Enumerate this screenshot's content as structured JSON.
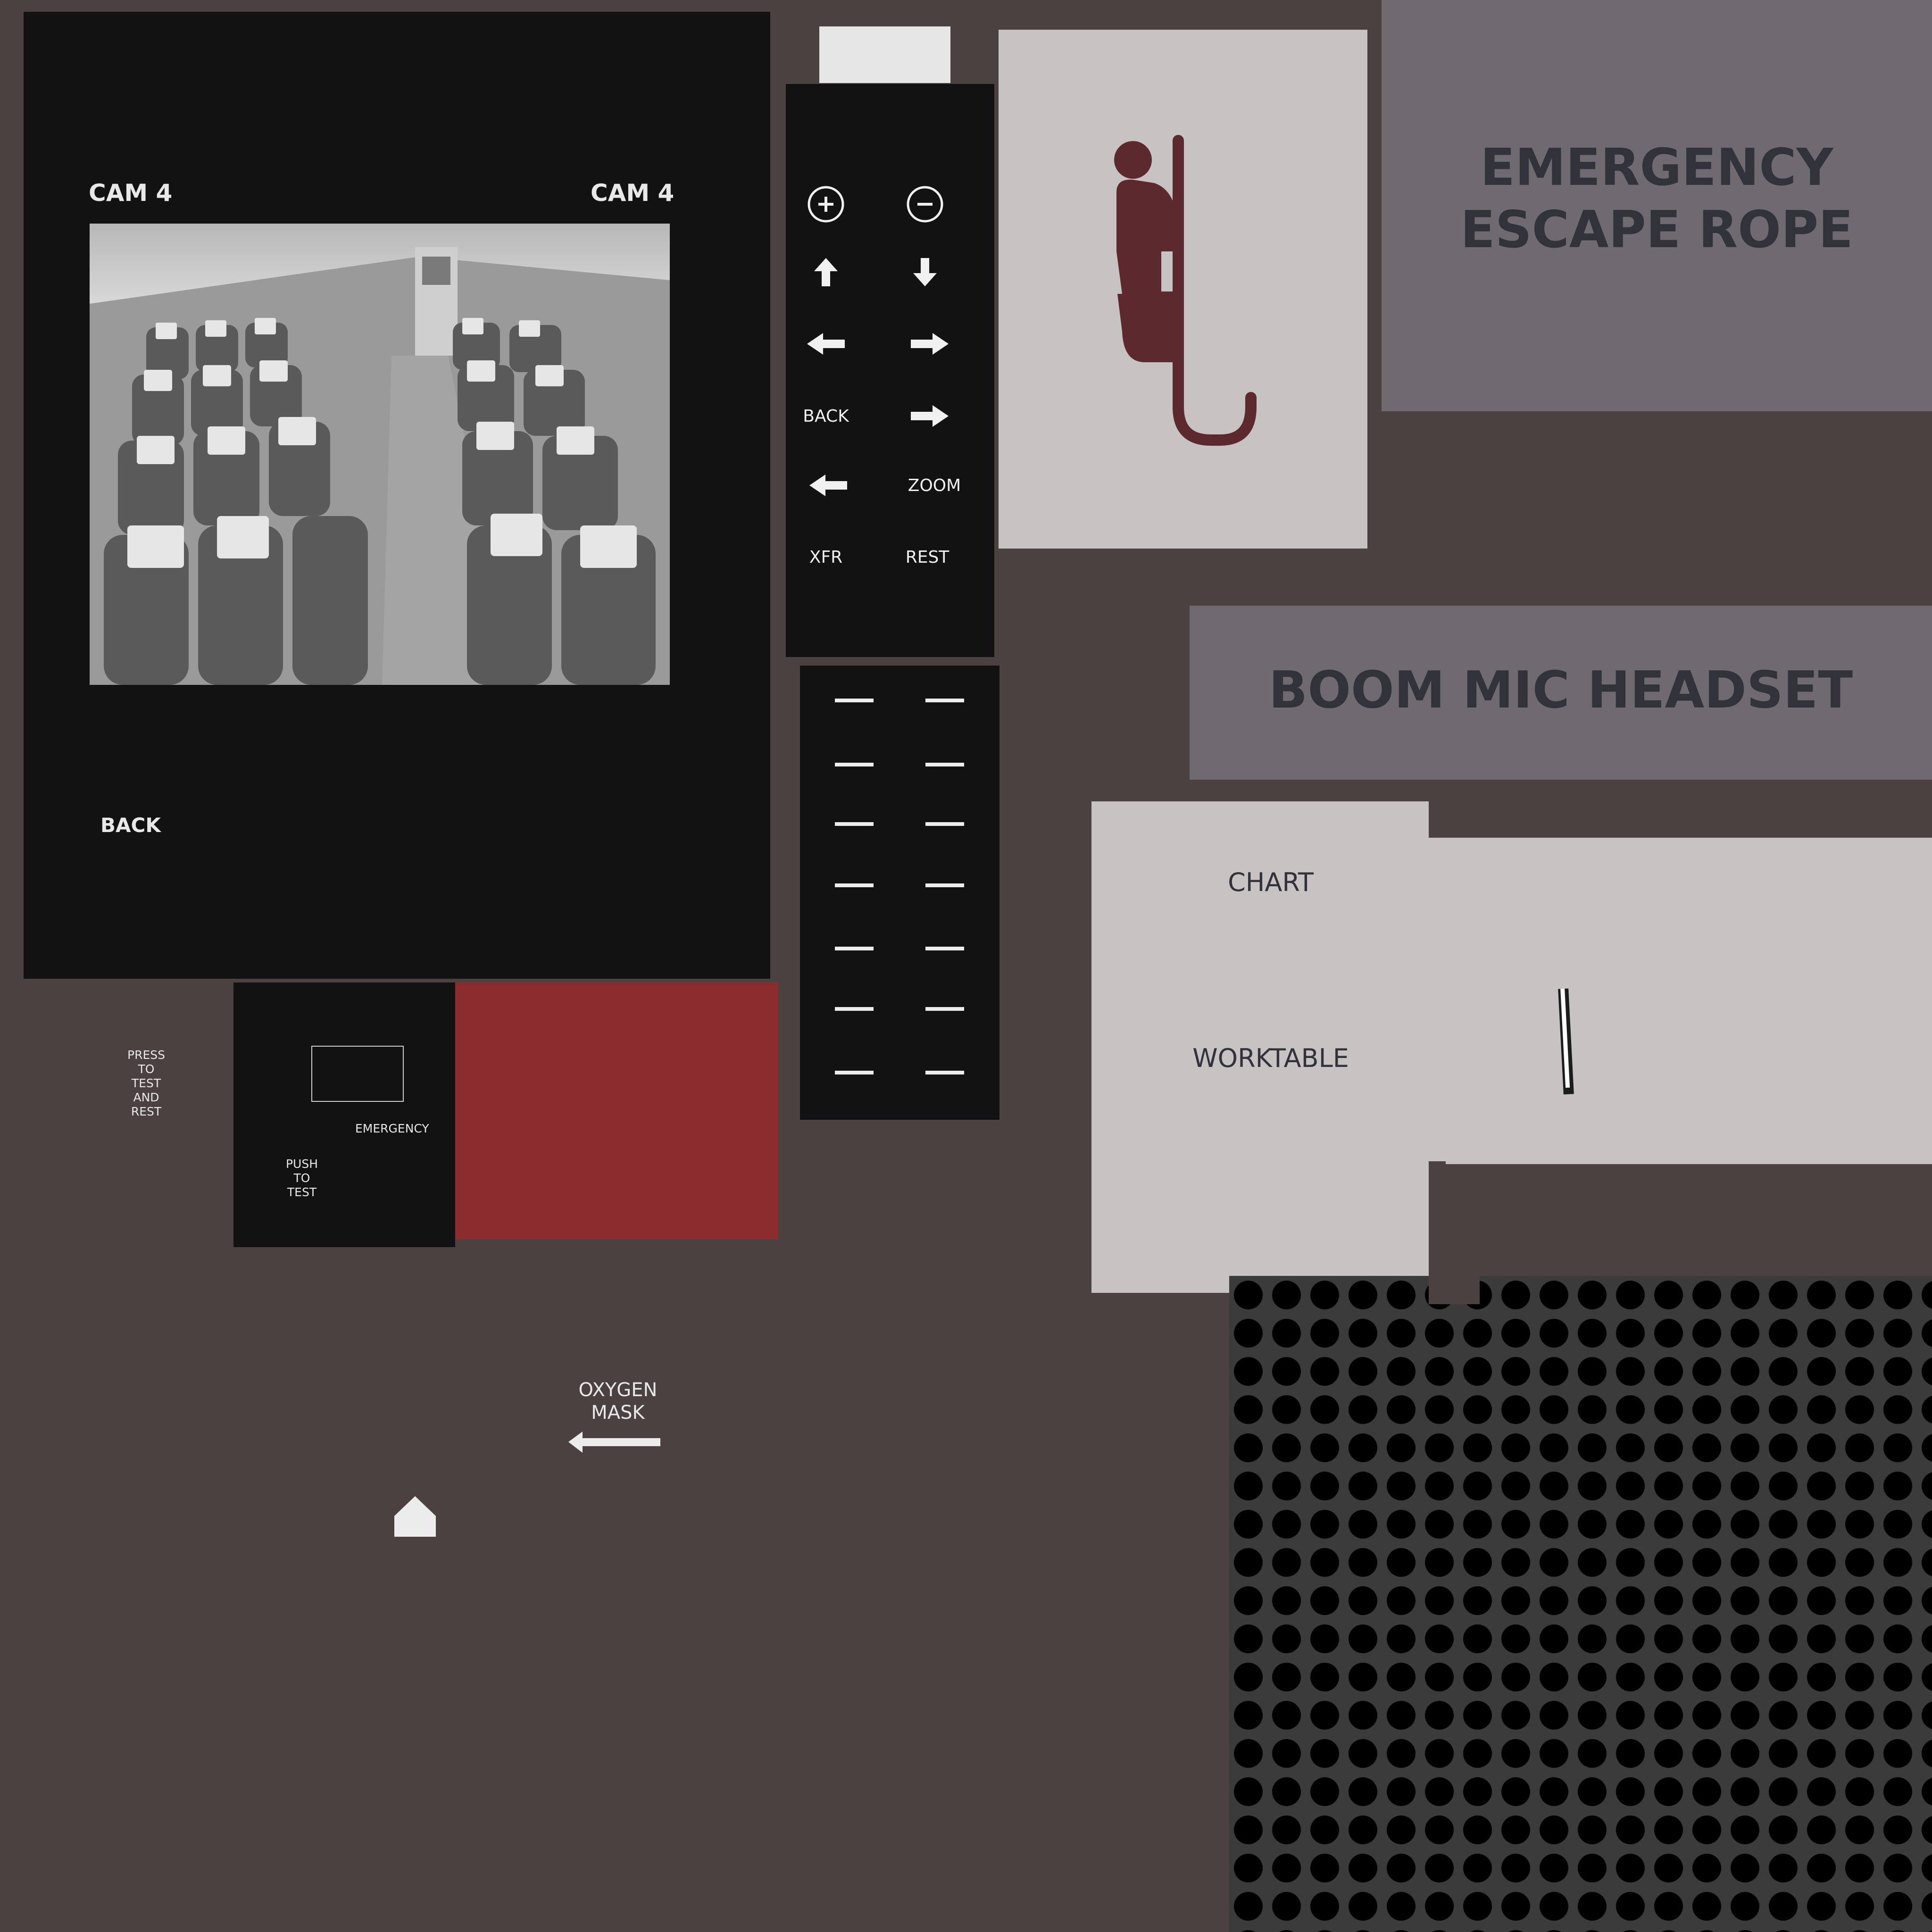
{
  "camera": {
    "label_left": "CAM 4",
    "label_right": "CAM 4",
    "back_label": "BACK",
    "feed_icon": "cabin-seats-camera-feed"
  },
  "keypad": {
    "back": "BACK",
    "zoom": "ZOOM",
    "xfr": "XFR",
    "rest": "REST",
    "icons": [
      "plus-icon",
      "minus-icon",
      "arrow-up-icon",
      "arrow-down-icon",
      "arrow-left-icon",
      "arrow-right-icon"
    ]
  },
  "placards": {
    "rope_line1": "EMERGENCY",
    "rope_line2": "ESCAPE ROPE",
    "boom_mic": "BOOM MIC HEADSET"
  },
  "worktable": {
    "chart": "CHART",
    "worktable": "WORKTABLE"
  },
  "test": {
    "press_to_test": [
      "PRESS",
      "TO",
      "TEST",
      "AND",
      "REST"
    ],
    "emergency": "EMERGENCY",
    "push_to_test": [
      "PUSH",
      "TO",
      "TEST"
    ]
  },
  "oxygen": {
    "line1": "OXYGEN",
    "line2": "MASK"
  },
  "colors": {
    "background": "#4a4140",
    "panel": "#121212",
    "placard_grey": "#6e6a70",
    "placard_light": "#c7c3c2",
    "rope_figure": "#5c2a2e",
    "test_red": "#8b2d2e"
  }
}
